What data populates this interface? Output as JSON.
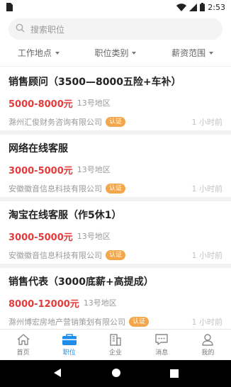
{
  "status": {
    "time": "2:53"
  },
  "search": {
    "placeholder": "搜索职位"
  },
  "filters": [
    {
      "label": "工作地点"
    },
    {
      "label": "职位类别"
    },
    {
      "label": "薪资范围"
    }
  ],
  "jobs": [
    {
      "title": "销售顾问（3500—8000五险+车补）",
      "salary": "5000-8000元",
      "area": "13号地区",
      "company": "滁州汇俊财务咨询有限公司",
      "badge": "认证",
      "time": "1 小时前"
    },
    {
      "title": "网络在线客服",
      "salary": "3000-5000元",
      "area": "13号地区",
      "company": "安徽徽音信息科技有限公司",
      "badge": "认证",
      "time": "1 小时前"
    },
    {
      "title": "淘宝在线客服（作5休1）",
      "salary": "3000-5000元",
      "area": "13号地区",
      "company": "安徽徽音信息科技有限公司",
      "badge": "认证",
      "time": "1 小时前"
    },
    {
      "title": "销售代表（3000底薪+高提成）",
      "salary": "8000-12000元",
      "area": "13号地区",
      "company": "滁州博宏房地产营销策划有限公司",
      "badge": "认证",
      "time": "1 小时前"
    }
  ],
  "tabs": [
    {
      "label": "首页",
      "icon": "home-icon"
    },
    {
      "label": "职位",
      "icon": "briefcase-icon",
      "active": true
    },
    {
      "label": "企业",
      "icon": "building-icon"
    },
    {
      "label": "消息",
      "icon": "message-icon"
    },
    {
      "label": "我的",
      "icon": "user-icon"
    }
  ],
  "colors": {
    "accent": "#1e8eea",
    "salary": "#e43b3b",
    "badge": "#f4a64a"
  }
}
